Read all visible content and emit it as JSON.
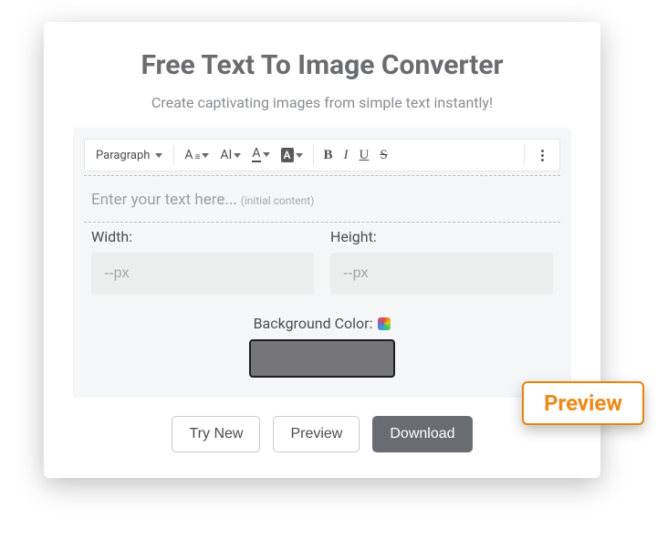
{
  "header": {
    "title": "Free Text To Image Converter",
    "subtitle": "Create captivating images from simple text instantly!"
  },
  "toolbar": {
    "paragraph": "Paragraph",
    "fontsize_glyph": "A",
    "case_glyph": "AI",
    "textcolor_glyph": "A",
    "bgcolor_glyph": "A",
    "bold": "B",
    "italic": "I",
    "underline": "U",
    "strike": "S"
  },
  "editor": {
    "placeholder": "Enter your text here...",
    "initial_note": "(initial content)"
  },
  "dims": {
    "width_label": "Width:",
    "height_label": "Height:",
    "px_placeholder": "--px"
  },
  "bg": {
    "label": "Background Color:",
    "value": "#767577"
  },
  "actions": {
    "try_new": "Try New",
    "preview": "Preview",
    "download": "Download"
  },
  "overlay": {
    "preview_tag": "Preview"
  }
}
